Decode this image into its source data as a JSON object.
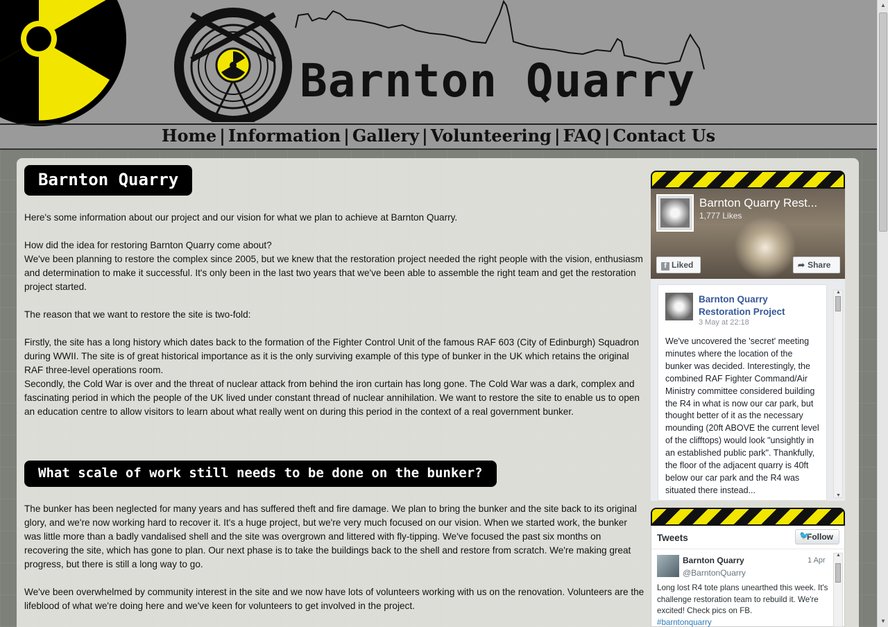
{
  "site": {
    "title": "Barnton Quarry"
  },
  "nav": {
    "items": [
      "Home",
      "Information",
      "Gallery",
      "Volunteering",
      "FAQ",
      "Contact Us"
    ],
    "separator": "|"
  },
  "main": {
    "heading": "Barnton Quarry",
    "intro": "Here's some information about our project and our vision for what we plan to achieve at Barnton Quarry.",
    "question1": "How did the idea for restoring Barnton Quarry come about?",
    "answer1": "We've been planning to restore the complex since 2005, but we knew that the restoration project needed the right people with the vision, enthusiasm and determination to make it successful. It's only been in the last two years that we've been able to assemble the right team and get the restoration project started.",
    "reason_intro": "The reason that we want to restore the site is two-fold:",
    "reason1": "Firstly, the site has a long history which dates back to the formation of the Fighter Control Unit of the famous RAF 603 (City of Edinburgh) Squadron during WWII. The site is of great historical importance as it is the only surviving example of this type of bunker in the UK which retains the original RAF three-level operations room.",
    "reason2": "Secondly, the Cold War is over and the threat of nuclear attack from behind the iron curtain has long gone. The Cold War was a dark, complex and fascinating period in which the people of the UK lived under constant thread of nuclear annihilation. We want to restore the site to enable us to open an education centre to allow visitors to learn about what really went on during this period in the context of a real government bunker.",
    "subheading": "What scale of work still needs to be done on the bunker?",
    "work_para": "The bunker has been neglected for many years and has suffered theft and fire damage. We plan to bring the bunker and the site back to its original glory, and we're now working hard to recover it. It's a huge project, but we're very much focused on our vision. When we started work, the bunker was little more than a badly vandalised shell and the site was overgrown and littered with fly-tipping. We've focused the past six months on recovering the site, which has gone to plan. Our next phase is to take the buildings back to the shell and restore from scratch. We're making great progress, but there is still a long way to go.",
    "volunteer_para": "We've been overwhelmed by community interest in the site and we now have lots of volunteers working with us on the renovation. Volunteers are the lifeblood of what we're doing here and we've keen for volunteers to get involved in the project."
  },
  "facebook": {
    "page_name": "Barnton Quarry Rest...",
    "likes": "1,777 Likes",
    "liked_label": "Liked",
    "share_label": "Share",
    "post": {
      "author": "Barnton Quarry Restoration Project",
      "time": "3 May at 22:18",
      "text": "We've uncovered the 'secret' meeting minutes where the location of the bunker was decided. Interestingly, the combined RAF Fighter Command/Air Ministry committee considered building the R4 in what is now our car park, but thought better of it as the necessary mounding (20ft ABOVE the current level of the clifftops) would look \"unsightly in an established public park\". Thankfully, the floor of the adjacent quarry is 40ft below our car park and the R4 was situated there instead..."
    }
  },
  "twitter": {
    "title": "Tweets",
    "follow_label": "Follow",
    "tweet": {
      "name": "Barnton Quarry",
      "handle": "@BarntonQuarry",
      "date": "1 Apr",
      "text": "Long lost R4 tote plans unearthed this week. It's challenge restoration team to rebuild it. We're excited! Check pics on FB.",
      "hashtag": "#barntonquarry"
    }
  },
  "icons": {
    "radiation": "radiation-icon",
    "facebook": "facebook-icon",
    "share": "share-icon",
    "twitter": "twitter-bird-icon"
  },
  "colors": {
    "hazard_yellow": "#f2e600",
    "heading_bg": "#000000",
    "fb_link": "#365899",
    "tw_link": "#2b7bb9"
  }
}
